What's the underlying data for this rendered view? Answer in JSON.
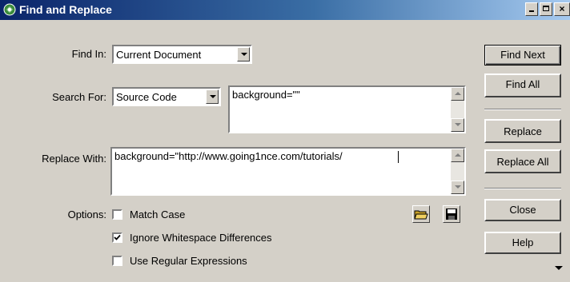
{
  "window": {
    "title": "Find and Replace",
    "controls": [
      "minimize",
      "maximize",
      "close"
    ]
  },
  "find_in": {
    "label": "Find In:",
    "value": "Current Document"
  },
  "search_for": {
    "label": "Search For:",
    "type_value": "Source Code",
    "text": "background=\"\""
  },
  "replace_with": {
    "label": "Replace With:",
    "text": "background=\"http://www.going1nce.com/tutorials/"
  },
  "options": {
    "label": "Options:",
    "match_case": {
      "label": "Match Case",
      "checked": false
    },
    "ignore_whitespace": {
      "label": "Ignore Whitespace Differences",
      "checked": true
    },
    "regex": {
      "label": "Use Regular Expressions",
      "checked": false
    }
  },
  "buttons": {
    "find_next": "Find Next",
    "find_all": "Find All",
    "replace": "Replace",
    "replace_all": "Replace All",
    "close": "Close",
    "help": "Help"
  },
  "icons": {
    "open_folder": "open-folder-icon",
    "save": "save-disk-icon"
  }
}
